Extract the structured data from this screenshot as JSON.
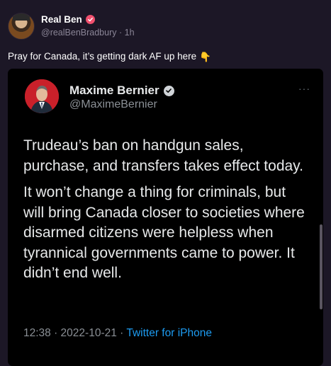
{
  "post": {
    "display_name": "Real Ben",
    "handle": "@realBenBradbury",
    "separator": "·",
    "time": "1h",
    "text": "Pray for Canada, it’s getting dark AF up here",
    "text_emoji": "👇"
  },
  "embedded_tweet": {
    "display_name": "Maxime Bernier",
    "handle": "@MaximeBernier",
    "more": "···",
    "paragraphs": [
      "Trudeau’s ban on handgun sales, purchase, and transfers takes effect today.",
      "It won’t change a thing for criminals, but will bring Canada closer to societies where disarmed citizens were helpless when tyrannical governments came to power. It didn’t end well."
    ],
    "timestamp": "12:38 · 2022-10-21 · ",
    "source": "Twitter for iPhone"
  },
  "colors": {
    "background": "#1c1726",
    "verified_badge": "#f0506e",
    "link": "#1d9bf0"
  }
}
